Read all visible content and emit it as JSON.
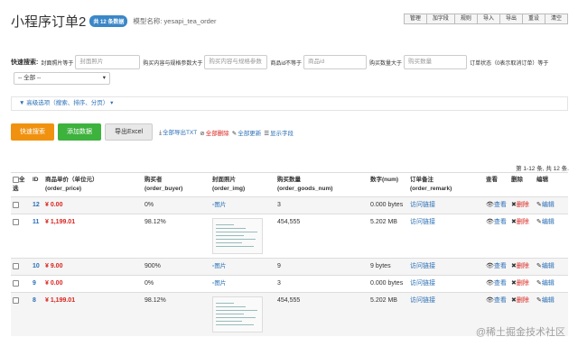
{
  "header": {
    "title": "小程序订单2",
    "badge": "共 12 条数据",
    "model_label": "模型名称: yesapi_tea_order"
  },
  "top_buttons": [
    "管理",
    "加字段",
    "规则",
    "导入",
    "导出",
    "重设",
    "清空"
  ],
  "search": {
    "label": "快速搜索:",
    "filters": [
      {
        "label": "封面照片等于",
        "placeholder": "封面照片"
      },
      {
        "label": "购买内容与规格参数大于",
        "placeholder": "购买内容与规格参数"
      },
      {
        "label": "商品id不等于",
        "placeholder": "商品id"
      },
      {
        "label": "购买数量大于",
        "placeholder": "购买数量"
      },
      {
        "label": "订单状态（0表示取消订单）等于",
        "placeholder": ""
      }
    ],
    "select_value": "-- 全部 --"
  },
  "advanced": "高级选项（搜索、排序、分页）",
  "actions": {
    "search_btn": "快速搜索",
    "add_btn": "添加数据",
    "export_btn": "导出Excel",
    "export_txt": "全部导出TXT",
    "delete_all": "全部删除",
    "update_all": "全部更新",
    "show_fields": "显示字段"
  },
  "pager": "第 1-12 条, 共 12 条.",
  "columns": {
    "all": "全选",
    "id": "ID",
    "price": "商品单价（单位元）",
    "price_key": "(order_price)",
    "buyer": "购买者",
    "buyer_key": "(order_buyer)",
    "img": "封面照片",
    "img_key": "(order_img)",
    "num": "购买数量",
    "num_key": "(order_goods_num)",
    "digit": "数字(num)",
    "remark": "订单备注",
    "remark_key": "(order_remark)",
    "view": "查看",
    "del": "删除",
    "edit": "编辑"
  },
  "row_labels": {
    "img_alt": "图片",
    "remark_link": "访问链接",
    "view_link": "查看",
    "del_link": "删除",
    "edit_link": "编辑"
  },
  "rows": [
    {
      "id": "12",
      "price": "¥ 0.00",
      "buyer": "0%",
      "img": "alt",
      "num": "3",
      "digit": "0.000 bytes"
    },
    {
      "id": "11",
      "price": "¥ 1,199.01",
      "buyer": "98.12%",
      "img": "thumb",
      "num": "454,555",
      "digit": "5.202 MB"
    },
    {
      "id": "10",
      "price": "¥ 9.00",
      "buyer": "900%",
      "img": "alt",
      "num": "9",
      "digit": "9 bytes"
    },
    {
      "id": "9",
      "price": "¥ 0.00",
      "buyer": "0%",
      "img": "alt",
      "num": "3",
      "digit": "0.000 bytes"
    },
    {
      "id": "8",
      "price": "¥ 1,199.01",
      "buyer": "98.12%",
      "img": "thumb",
      "num": "454,555",
      "digit": "5.202 MB"
    }
  ],
  "watermark": "@稀土掘金技术社区"
}
